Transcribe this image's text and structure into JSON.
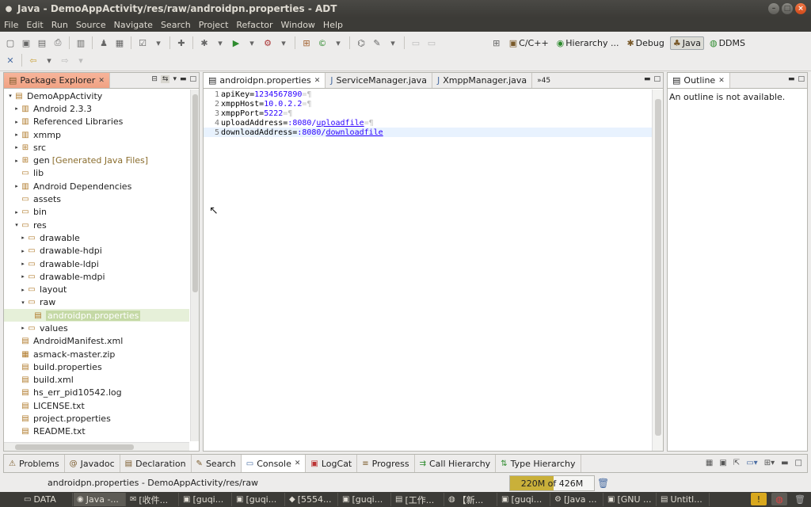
{
  "window": {
    "title": "Java - DemoAppActivity/res/raw/androidpn.properties - ADT"
  },
  "menu": [
    "File",
    "Edit",
    "Run",
    "Source",
    "Navigate",
    "Search",
    "Project",
    "Refactor",
    "Window",
    "Help"
  ],
  "perspectives": [
    {
      "label": "C/C++",
      "icon": "c-cpp-icon",
      "active": false
    },
    {
      "label": "Hierarchy ...",
      "icon": "hierarchy-icon",
      "active": false
    },
    {
      "label": "Debug",
      "icon": "debug-icon",
      "active": false
    },
    {
      "label": "Java",
      "icon": "java-icon",
      "active": true
    },
    {
      "label": "DDMS",
      "icon": "ddms-icon",
      "active": false
    }
  ],
  "package_explorer": {
    "title": "Package Explorer",
    "items": [
      {
        "label": "DemoAppActivity",
        "arrow": "▾",
        "icon": "project-icon",
        "level": 0
      },
      {
        "label": "Android 2.3.3",
        "arrow": "▸",
        "icon": "library-icon",
        "level": 1
      },
      {
        "label": "Referenced Libraries",
        "arrow": "▸",
        "icon": "library-icon",
        "level": 1
      },
      {
        "label": "xmmp",
        "arrow": "▸",
        "icon": "library-icon",
        "level": 1
      },
      {
        "label": "src",
        "arrow": "▸",
        "icon": "source-folder-icon",
        "level": 1
      },
      {
        "label": "gen",
        "decor": "[Generated Java Files]",
        "arrow": "▸",
        "icon": "source-folder-icon",
        "level": 1
      },
      {
        "label": "lib",
        "arrow": "",
        "icon": "folder-icon",
        "level": 1
      },
      {
        "label": "Android Dependencies",
        "arrow": "▸",
        "icon": "library-icon",
        "level": 1
      },
      {
        "label": "assets",
        "arrow": "",
        "icon": "folder-icon",
        "level": 1
      },
      {
        "label": "bin",
        "arrow": "▸",
        "icon": "folder-icon",
        "level": 1
      },
      {
        "label": "res",
        "arrow": "▾",
        "icon": "folder-icon",
        "level": 1
      },
      {
        "label": "drawable",
        "arrow": "▸",
        "icon": "folder-icon",
        "level": 2
      },
      {
        "label": "drawable-hdpi",
        "arrow": "▸",
        "icon": "folder-icon",
        "level": 2
      },
      {
        "label": "drawable-ldpi",
        "arrow": "▸",
        "icon": "folder-icon",
        "level": 2
      },
      {
        "label": "drawable-mdpi",
        "arrow": "▸",
        "icon": "folder-icon",
        "level": 2
      },
      {
        "label": "layout",
        "arrow": "▸",
        "icon": "folder-icon",
        "level": 2
      },
      {
        "label": "raw",
        "arrow": "▾",
        "icon": "folder-icon",
        "level": 2
      },
      {
        "label": "androidpn.properties",
        "arrow": "",
        "icon": "file-icon",
        "level": 3,
        "selected": true
      },
      {
        "label": "values",
        "arrow": "▸",
        "icon": "folder-icon",
        "level": 2
      },
      {
        "label": "AndroidManifest.xml",
        "arrow": "",
        "icon": "xml-file-icon",
        "level": 1
      },
      {
        "label": "asmack-master.zip",
        "arrow": "",
        "icon": "zip-file-icon",
        "level": 1
      },
      {
        "label": "build.properties",
        "arrow": "",
        "icon": "file-icon",
        "level": 1
      },
      {
        "label": "build.xml",
        "arrow": "",
        "icon": "xml-file-icon",
        "level": 1
      },
      {
        "label": "hs_err_pid10542.log",
        "arrow": "",
        "icon": "file-icon",
        "level": 1
      },
      {
        "label": "LICENSE.txt",
        "arrow": "",
        "icon": "file-icon",
        "level": 1
      },
      {
        "label": "project.properties",
        "arrow": "",
        "icon": "file-icon",
        "level": 1
      },
      {
        "label": "README.txt",
        "arrow": "",
        "icon": "file-icon",
        "level": 1
      }
    ]
  },
  "editor": {
    "tabs": [
      {
        "label": "androidpn.properties",
        "active": true,
        "close": true
      },
      {
        "label": "ServiceManager.java",
        "active": false,
        "close": false
      },
      {
        "label": "XmppManager.java",
        "active": false,
        "close": false
      }
    ],
    "overflow": "»45",
    "lines": [
      {
        "num": "1",
        "key": "apiKey=",
        "value": "1234567890",
        "link": false,
        "pilcrow": true,
        "current": false
      },
      {
        "num": "2",
        "key": "xmppHost=",
        "value": "10.0.2.2",
        "link": false,
        "pilcrow": true,
        "current": false
      },
      {
        "num": "3",
        "key": "xmppPort=",
        "value": "5222",
        "link": false,
        "pilcrow": true,
        "current": false
      },
      {
        "num": "4",
        "key": "uploadAddress=",
        "value_prefix": ":8080/",
        "value": "uploadfile",
        "link": true,
        "pilcrow": true,
        "current": false
      },
      {
        "num": "5",
        "key": "downloadAddress=",
        "value_prefix": ":8080/",
        "value": "downloadfile",
        "link": true,
        "pilcrow": false,
        "current": true
      }
    ]
  },
  "outline": {
    "title": "Outline",
    "message": "An outline is not available."
  },
  "bottom_tabs": [
    {
      "label": "Problems",
      "icon": "problems-icon"
    },
    {
      "label": "Javadoc",
      "icon": "javadoc-icon"
    },
    {
      "label": "Declaration",
      "icon": "declaration-icon"
    },
    {
      "label": "Search",
      "icon": "search-icon"
    },
    {
      "label": "Console",
      "icon": "console-icon",
      "active": true
    },
    {
      "label": "LogCat",
      "icon": "logcat-icon"
    },
    {
      "label": "Progress",
      "icon": "progress-icon"
    },
    {
      "label": "Call Hierarchy",
      "icon": "call-hierarchy-icon"
    },
    {
      "label": "Type Hierarchy",
      "icon": "type-hierarchy-icon"
    }
  ],
  "status": {
    "path": "androidpn.properties - DemoAppActivity/res/raw",
    "heap": "220M of 426M",
    "heap_fraction": 0.516
  },
  "taskbar": [
    {
      "label": "DATA",
      "icon": "folder-icon"
    },
    {
      "label": "Java -...",
      "icon": "eclipse-icon",
      "active": true
    },
    {
      "label": "[收件...",
      "icon": "mail-icon"
    },
    {
      "label": "[guqi...",
      "icon": "terminal-icon"
    },
    {
      "label": "[guqi...",
      "icon": "terminal-icon"
    },
    {
      "label": "[5554...",
      "icon": "emulator-icon"
    },
    {
      "label": "[guqi...",
      "icon": "terminal-icon"
    },
    {
      "label": "[工作...",
      "icon": "document-icon"
    },
    {
      "label": "【新...",
      "icon": "chrome-icon"
    },
    {
      "label": "[guqi...",
      "icon": "terminal-icon"
    },
    {
      "label": "[Java ...",
      "icon": "gear-icon"
    },
    {
      "label": "[GNU ...",
      "icon": "terminal-icon"
    },
    {
      "label": "Untitl...",
      "icon": "document-icon"
    }
  ]
}
